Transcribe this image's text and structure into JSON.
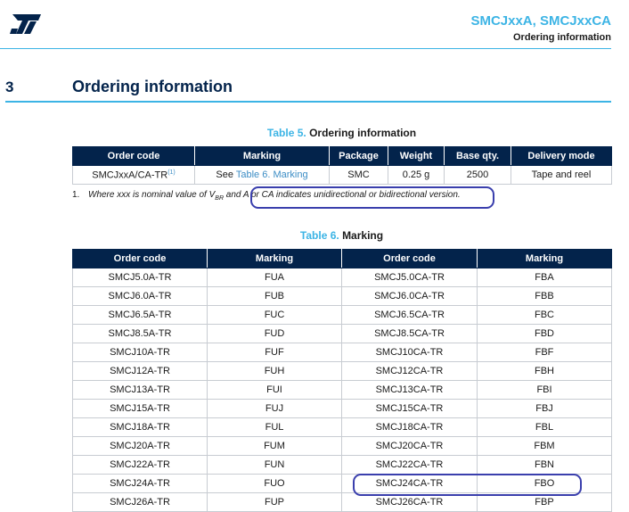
{
  "header": {
    "doc_title": "SMCJxxA, SMCJxxCA",
    "subtitle": "Ordering information"
  },
  "section": {
    "number": "3",
    "title": "Ordering information"
  },
  "table5": {
    "label": "Table 5.",
    "title": "Ordering information",
    "columns": [
      "Order code",
      "Marking",
      "Package",
      "Weight",
      "Base qty.",
      "Delivery mode"
    ],
    "row": {
      "order_code": "SMCJxxA/CA-TR",
      "order_code_note": "(1)",
      "marking_prefix": "See ",
      "marking_link": "Table 6. Marking",
      "package": "SMC",
      "weight": "0.25 g",
      "base_qty": "2500",
      "delivery_mode": "Tape and reel"
    },
    "footnote": {
      "number": "1.",
      "text_before": "Where xxx is nominal value of V",
      "subscript": "BR",
      "text_after": " and A or CA indicates unidirectional or bidirectional version."
    }
  },
  "table6": {
    "label": "Table 6.",
    "title": "Marking",
    "columns": [
      "Order code",
      "Marking",
      "Order code",
      "Marking"
    ],
    "rows": [
      [
        "SMCJ5.0A-TR",
        "FUA",
        "SMCJ5.0CA-TR",
        "FBA"
      ],
      [
        "SMCJ6.0A-TR",
        "FUB",
        "SMCJ6.0CA-TR",
        "FBB"
      ],
      [
        "SMCJ6.5A-TR",
        "FUC",
        "SMCJ6.5CA-TR",
        "FBC"
      ],
      [
        "SMCJ8.5A-TR",
        "FUD",
        "SMCJ8.5CA-TR",
        "FBD"
      ],
      [
        "SMCJ10A-TR",
        "FUF",
        "SMCJ10CA-TR",
        "FBF"
      ],
      [
        "SMCJ12A-TR",
        "FUH",
        "SMCJ12CA-TR",
        "FBH"
      ],
      [
        "SMCJ13A-TR",
        "FUI",
        "SMCJ13CA-TR",
        "FBI"
      ],
      [
        "SMCJ15A-TR",
        "FUJ",
        "SMCJ15CA-TR",
        "FBJ"
      ],
      [
        "SMCJ18A-TR",
        "FUL",
        "SMCJ18CA-TR",
        "FBL"
      ],
      [
        "SMCJ20A-TR",
        "FUM",
        "SMCJ20CA-TR",
        "FBM"
      ],
      [
        "SMCJ22A-TR",
        "FUN",
        "SMCJ22CA-TR",
        "FBN"
      ],
      [
        "SMCJ24A-TR",
        "FUO",
        "SMCJ24CA-TR",
        "FBO"
      ],
      [
        "SMCJ26A-TR",
        "FUP",
        "SMCJ26CA-TR",
        "FBP"
      ]
    ]
  },
  "colors": {
    "accent": "#3cb4e5",
    "header_navy": "#03234b",
    "annotation": "#3a3fad"
  },
  "logo_icon": "st-logo"
}
